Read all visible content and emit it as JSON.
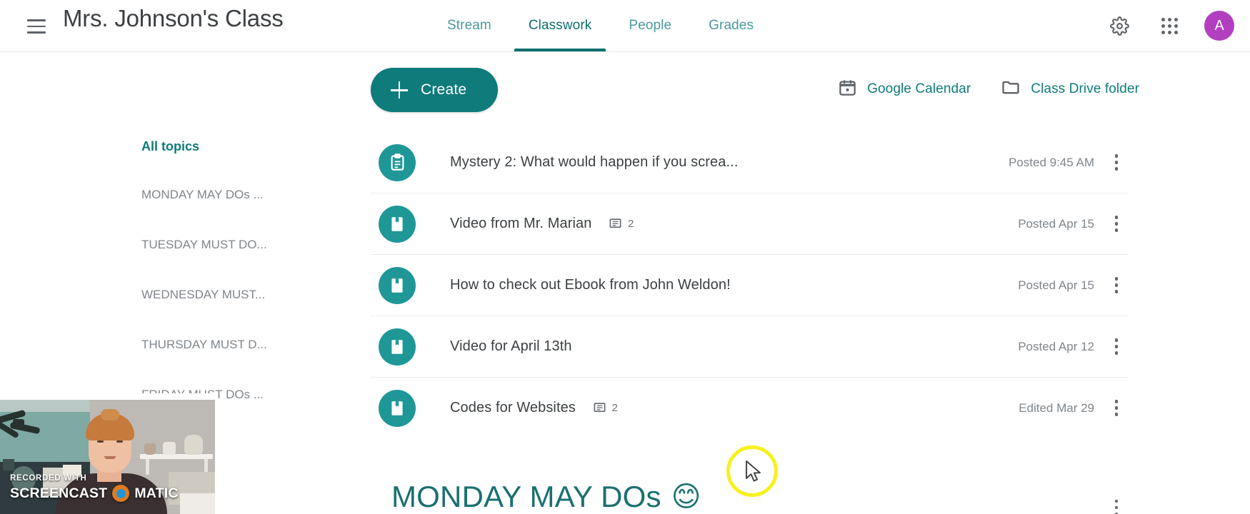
{
  "header": {
    "menu_icon": "hamburger-menu-icon",
    "class_title": "Mrs. Johnson's Class",
    "tabs": [
      {
        "label": "Stream",
        "active": false
      },
      {
        "label": "Classwork",
        "active": true
      },
      {
        "label": "People",
        "active": false
      },
      {
        "label": "Grades",
        "active": false
      }
    ],
    "settings_icon": "gear-icon",
    "apps_icon": "apps-grid-icon",
    "avatar_initial": "A",
    "avatar_color": "#b23fc0"
  },
  "toolbar": {
    "create_label": "Create",
    "create_icon": "plus-icon",
    "create_color": "#0f7b7b",
    "links": [
      {
        "label": "Google Calendar",
        "icon": "calendar-icon"
      },
      {
        "label": "Class Drive folder",
        "icon": "folder-icon"
      }
    ]
  },
  "sidebar": {
    "all_topics_label": "All topics",
    "topics": [
      "MONDAY MAY DOs ...",
      "TUESDAY MUST DO...",
      "WEDNESDAY MUST...",
      "THURSDAY MUST D...",
      "FRIDAY MUST DOs ..."
    ]
  },
  "classwork": {
    "rows": [
      {
        "title": "Mystery 2: What would happen if you screa...",
        "icon": "assignment-clipboard-icon",
        "comments": null,
        "date": "Posted 9:45 AM"
      },
      {
        "title": "Video from Mr. Marian",
        "icon": "material-book-icon",
        "comments": "2",
        "date": "Posted Apr 15"
      },
      {
        "title": "How to check out Ebook from John Weldon!",
        "icon": "material-book-icon",
        "comments": null,
        "date": "Posted Apr 15"
      },
      {
        "title": "Video for April 13th",
        "icon": "material-book-icon",
        "comments": null,
        "date": "Posted Apr 12"
      },
      {
        "title": "Codes for Websites",
        "icon": "material-book-icon",
        "comments": "2",
        "date": "Edited Mar 29"
      }
    ],
    "bottom_topic": "MONDAY MAY DOs",
    "bottom_topic_emoji": "😊"
  },
  "overlay": {
    "recorded_with": "RECORDED WITH",
    "brand_left": "SCREENCAST",
    "brand_right": "MATIC",
    "logo_icon": "screencast-o-matic-logo-icon"
  },
  "cursor": {
    "highlight_color": "#f7f020",
    "icon": "mouse-pointer-icon"
  }
}
